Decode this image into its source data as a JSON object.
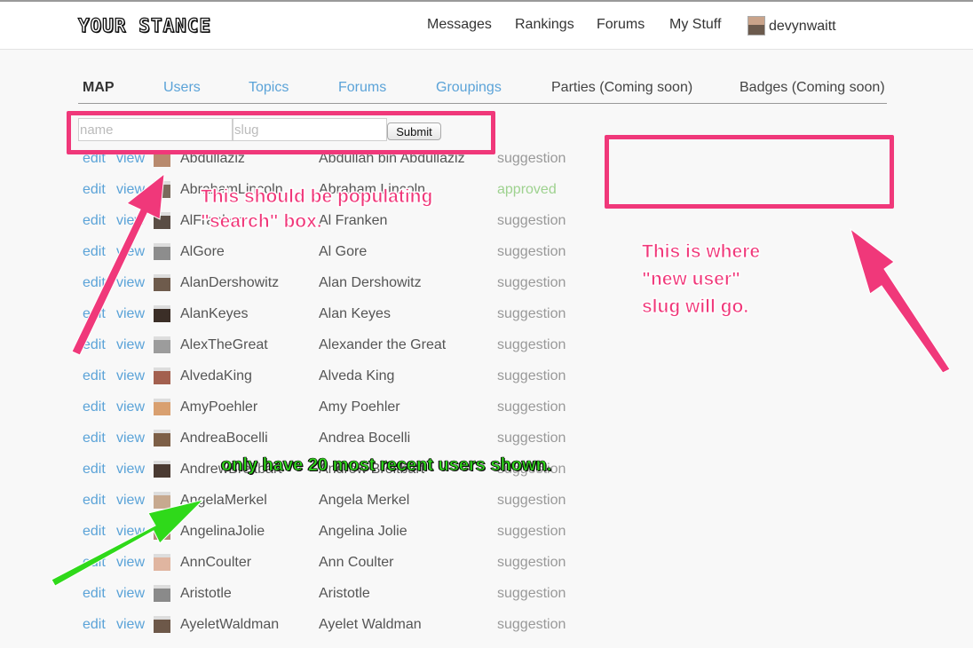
{
  "header": {
    "logo": "YOUR STANCE",
    "nav": [
      "Messages",
      "Rankings",
      "Forums",
      "My Stuff"
    ],
    "username": "devynwaitt"
  },
  "tabs": {
    "map": "MAP",
    "users": "Users",
    "topics": "Topics",
    "forums": "Forums",
    "groupings": "Groupings",
    "parties": "Parties (Coming soon)",
    "badges": "Badges (Coming soon)"
  },
  "form": {
    "name_placeholder": "name",
    "slug_placeholder": "slug",
    "submit_label": "Submit"
  },
  "row_labels": {
    "edit": "edit",
    "view": "view"
  },
  "users": [
    {
      "username": "Abdullaziz",
      "fullname": "Abdullah bin Abdullaziz",
      "status": "suggestion"
    },
    {
      "username": "AbrahamLincoln",
      "fullname": "Abraham Lincoln",
      "status": "approved"
    },
    {
      "username": "AlFranken",
      "fullname": "Al Franken",
      "status": "suggestion"
    },
    {
      "username": "AlGore",
      "fullname": "Al Gore",
      "status": "suggestion"
    },
    {
      "username": "AlanDershowitz",
      "fullname": "Alan Dershowitz",
      "status": "suggestion"
    },
    {
      "username": "AlanKeyes",
      "fullname": "Alan Keyes",
      "status": "suggestion"
    },
    {
      "username": "AlexTheGreat",
      "fullname": "Alexander the Great",
      "status": "suggestion"
    },
    {
      "username": "AlvedaKing",
      "fullname": "Alveda King",
      "status": "suggestion"
    },
    {
      "username": "AmyPoehler",
      "fullname": "Amy Poehler",
      "status": "suggestion"
    },
    {
      "username": "AndreaBocelli",
      "fullname": "Andrea Bocelli",
      "status": "suggestion"
    },
    {
      "username": "AndrewBreitbart",
      "fullname": "Andrew Breitbart",
      "status": "suggestion"
    },
    {
      "username": "AngelaMerkel",
      "fullname": "Angela Merkel",
      "status": "suggestion"
    },
    {
      "username": "AngelinaJolie",
      "fullname": "Angelina Jolie",
      "status": "suggestion"
    },
    {
      "username": "AnnCoulter",
      "fullname": "Ann Coulter",
      "status": "suggestion"
    },
    {
      "username": "Aristotle",
      "fullname": "Aristotle",
      "status": "suggestion"
    },
    {
      "username": "AyeletWaldman",
      "fullname": "Ayelet Waldman",
      "status": "suggestion"
    }
  ],
  "annotations": {
    "search_note_line1": "This should be populating",
    "search_note_line2": "\"search\" box.",
    "slug_note_line1": "This is where",
    "slug_note_line2": "\"new user\"",
    "slug_note_line3": "slug will go.",
    "recent_note": "only have 20 most recent users shown."
  },
  "colors": {
    "link": "#5ba3d8",
    "approved": "#9ed28f",
    "annotation_pink": "#f0387a",
    "annotation_green": "#2fd91a"
  }
}
